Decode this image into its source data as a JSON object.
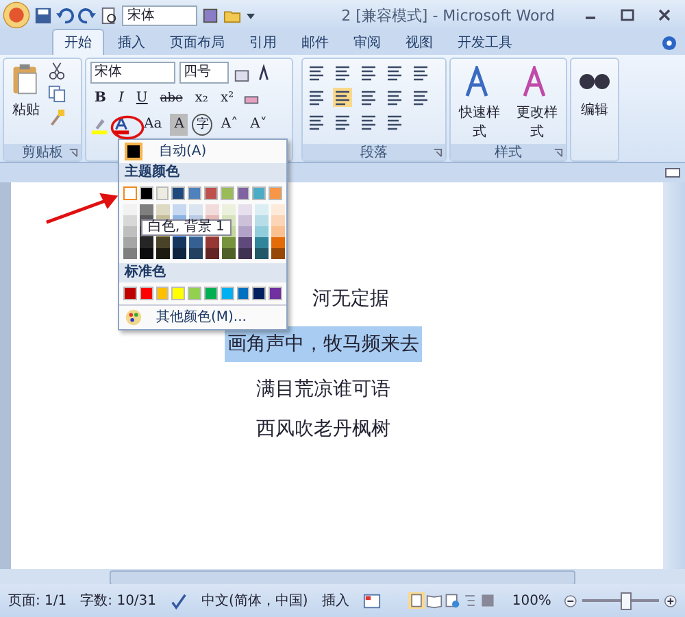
{
  "window": {
    "title": "2 [兼容模式] - Microsoft Word"
  },
  "quick_access": {
    "font": "宋体"
  },
  "tabs": [
    {
      "label": "开始",
      "selected": true
    },
    {
      "label": "插入",
      "selected": false
    },
    {
      "label": "页面布局",
      "selected": false
    },
    {
      "label": "引用",
      "selected": false
    },
    {
      "label": "邮件",
      "selected": false
    },
    {
      "label": "审阅",
      "selected": false
    },
    {
      "label": "视图",
      "selected": false
    },
    {
      "label": "开发工具",
      "selected": false
    }
  ],
  "ribbon": {
    "clipboard": {
      "paste": "粘贴",
      "label": "剪贴板"
    },
    "font": {
      "name": "宋体",
      "size": "四号",
      "format_buttons": [
        {
          "label": "B",
          "kind": "bold"
        },
        {
          "label": "I",
          "kind": "italic"
        },
        {
          "label": "U",
          "kind": "underline"
        },
        {
          "label": "abe",
          "kind": "strike"
        },
        {
          "label": "x₂",
          "kind": "plain"
        },
        {
          "label": "x²",
          "kind": "plain"
        }
      ],
      "effect_buttons": [
        {
          "label": "Aa",
          "kind": "plain"
        },
        {
          "label": "A",
          "kind": "shaded"
        },
        {
          "label": "字",
          "kind": "circled"
        },
        {
          "label": "A˄",
          "kind": "plain"
        },
        {
          "label": "A˅",
          "kind": "plain"
        }
      ]
    },
    "paragraph": {
      "label": "段落"
    },
    "styles": {
      "buttons": [
        "快速样式",
        "更改样式"
      ],
      "label": "样式"
    },
    "editing": {
      "button": "编辑"
    }
  },
  "color_menu": {
    "automatic": "自动(A)",
    "theme_header": "主题颜色",
    "theme_colors": [
      {
        "color": "#ffffff",
        "selected": true,
        "shades": [
          {
            "color": "#f2f2f2"
          },
          {
            "color": "#d8d8d8"
          },
          {
            "color": "#bfbfbf"
          },
          {
            "color": "#a5a5a5"
          },
          {
            "color": "#7f7f7f"
          }
        ]
      },
      {
        "color": "#000000",
        "selected": false,
        "shades": [
          {
            "color": "#7f7f7f"
          },
          {
            "color": "#595959"
          },
          {
            "color": "#3f3f3f"
          },
          {
            "color": "#262626"
          },
          {
            "color": "#0c0c0c"
          }
        ]
      },
      {
        "color": "#eeece1",
        "selected": false,
        "shades": [
          {
            "color": "#ddd9c3"
          },
          {
            "color": "#c4bd97"
          },
          {
            "color": "#938953"
          },
          {
            "color": "#494429"
          },
          {
            "color": "#1d1b10"
          }
        ]
      },
      {
        "color": "#1f497d",
        "selected": false,
        "shades": [
          {
            "color": "#c6d9f0"
          },
          {
            "color": "#8db3e2"
          },
          {
            "color": "#548dd4"
          },
          {
            "color": "#17365d"
          },
          {
            "color": "#0f243e"
          }
        ]
      },
      {
        "color": "#4f81bd",
        "selected": false,
        "shades": [
          {
            "color": "#dbe5f1"
          },
          {
            "color": "#b8cce4"
          },
          {
            "color": "#95b3d7"
          },
          {
            "color": "#366092"
          },
          {
            "color": "#244061"
          }
        ]
      },
      {
        "color": "#c0504d",
        "selected": false,
        "shades": [
          {
            "color": "#f2dcdb"
          },
          {
            "color": "#e5b9b7"
          },
          {
            "color": "#d99694"
          },
          {
            "color": "#953734"
          },
          {
            "color": "#632423"
          }
        ]
      },
      {
        "color": "#9bbb59",
        "selected": false,
        "shades": [
          {
            "color": "#ebf1dd"
          },
          {
            "color": "#d7e3bc"
          },
          {
            "color": "#c3d69b"
          },
          {
            "color": "#76923c"
          },
          {
            "color": "#4f6128"
          }
        ]
      },
      {
        "color": "#8064a2",
        "selected": false,
        "shades": [
          {
            "color": "#e5e0ec"
          },
          {
            "color": "#ccc1d9"
          },
          {
            "color": "#b2a2c7"
          },
          {
            "color": "#5f497a"
          },
          {
            "color": "#3f3151"
          }
        ]
      },
      {
        "color": "#4bacc6",
        "selected": false,
        "shades": [
          {
            "color": "#dbeef3"
          },
          {
            "color": "#b7dde8"
          },
          {
            "color": "#92cddc"
          },
          {
            "color": "#31859b"
          },
          {
            "color": "#205867"
          }
        ]
      },
      {
        "color": "#f79646",
        "selected": false,
        "shades": [
          {
            "color": "#fdeada"
          },
          {
            "color": "#fbd5b5"
          },
          {
            "color": "#fac08f"
          },
          {
            "color": "#e36c09"
          },
          {
            "color": "#974806"
          }
        ]
      }
    ],
    "tooltip": "白色, 背景 1",
    "standard_header": "标准色",
    "standard_colors": [
      {
        "color": "#c00000"
      },
      {
        "color": "#ff0000"
      },
      {
        "color": "#ffc000"
      },
      {
        "color": "#ffff00"
      },
      {
        "color": "#92d050"
      },
      {
        "color": "#00b050"
      },
      {
        "color": "#00b0f0"
      },
      {
        "color": "#0070c0"
      },
      {
        "color": "#002060"
      },
      {
        "color": "#7030a0"
      }
    ],
    "more": "其他颜色(M)..."
  },
  "document": {
    "lines": [
      {
        "text": "河无定据",
        "selected": false
      },
      {
        "text": "画角声中，牧马频来去",
        "selected": true
      },
      {
        "text": "满目荒凉谁可语",
        "selected": false
      },
      {
        "text": "西风吹老丹枫树",
        "selected": false
      }
    ]
  },
  "status_bar": {
    "page": "页面: 1/1",
    "words": "字数: 10/31",
    "language": "中文(简体，中国)",
    "mode": "插入",
    "zoom": "100%",
    "zoom_slider": {
      "level": 0.55
    }
  }
}
